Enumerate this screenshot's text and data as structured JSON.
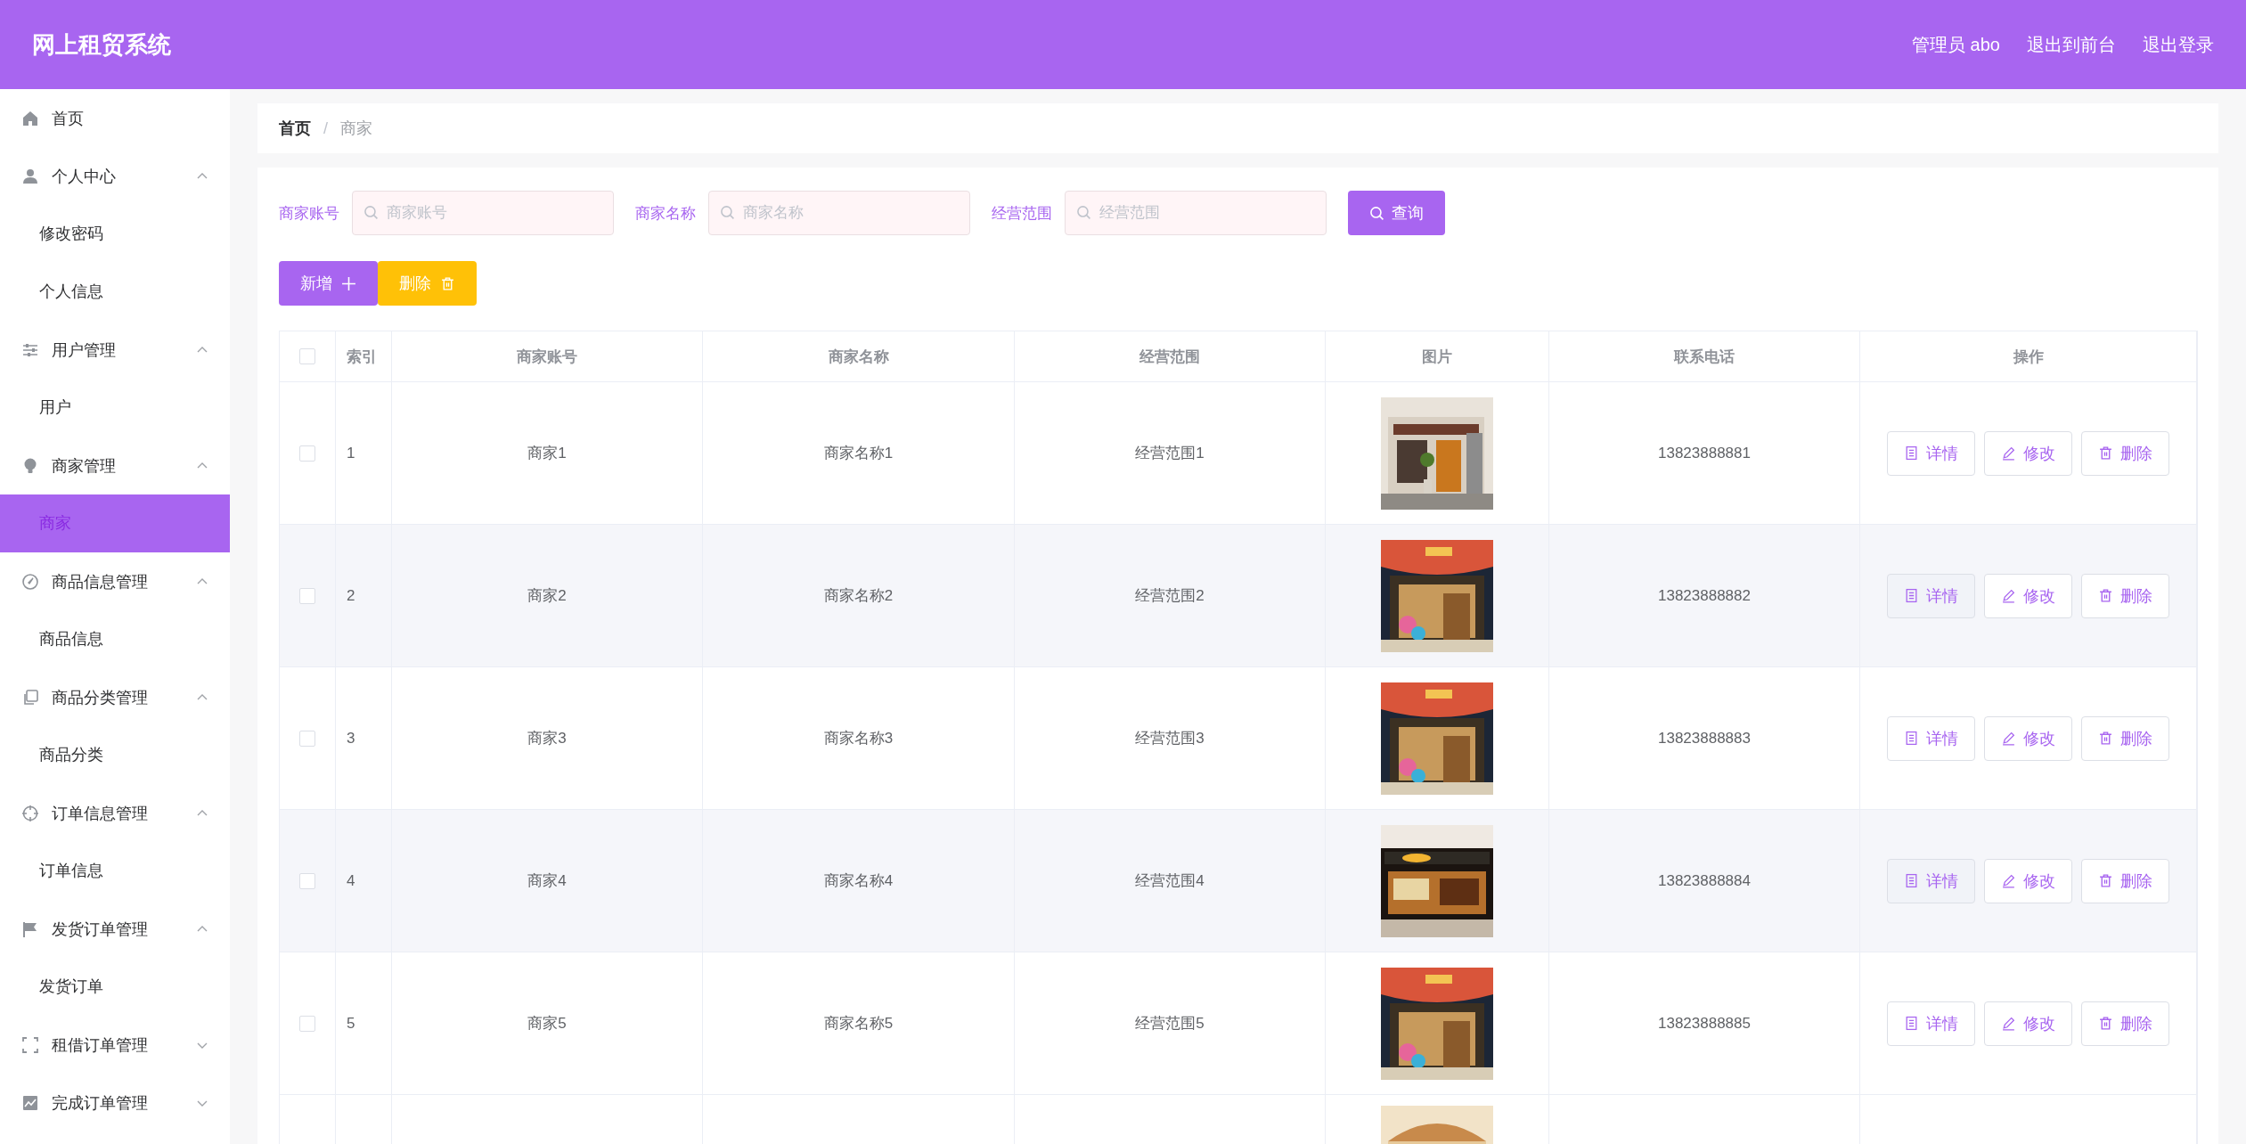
{
  "app": {
    "title": "网上租贸系统",
    "user_label": "管理员 abo",
    "links": [
      "退出到前台",
      "退出登录"
    ]
  },
  "sidebar": {
    "items": [
      {
        "label": "首页",
        "selected": false
      },
      {
        "label": "个人中心",
        "expanded": true,
        "children": [
          {
            "label": "修改密码",
            "selected": false
          },
          {
            "label": "个人信息",
            "selected": false
          }
        ]
      },
      {
        "label": "用户管理",
        "expanded": true,
        "children": [
          {
            "label": "用户",
            "selected": false
          }
        ]
      },
      {
        "label": "商家管理",
        "expanded": true,
        "children": [
          {
            "label": "商家",
            "selected": true
          }
        ]
      },
      {
        "label": "商品信息管理",
        "expanded": true,
        "children": [
          {
            "label": "商品信息",
            "selected": false
          }
        ]
      },
      {
        "label": "商品分类管理",
        "expanded": true,
        "children": [
          {
            "label": "商品分类",
            "selected": false
          }
        ]
      },
      {
        "label": "订单信息管理",
        "expanded": true,
        "children": [
          {
            "label": "订单信息",
            "selected": false
          }
        ]
      },
      {
        "label": "发货订单管理",
        "expanded": true,
        "children": [
          {
            "label": "发货订单",
            "selected": false
          }
        ]
      },
      {
        "label": "租借订单管理",
        "expanded": false
      },
      {
        "label": "完成订单管理",
        "expanded": false
      }
    ]
  },
  "breadcrumb": {
    "items": [
      "首页",
      "商家"
    ],
    "separator": "/"
  },
  "search": {
    "fields": [
      {
        "label": "商家账号",
        "placeholder": "商家账号"
      },
      {
        "label": "商家名称",
        "placeholder": "商家名称"
      },
      {
        "label": "经营范围",
        "placeholder": "经营范围"
      }
    ],
    "button": "查询"
  },
  "actions": [
    {
      "label": "新增",
      "kind": "add"
    },
    {
      "label": "删除",
      "kind": "delete"
    }
  ],
  "table": {
    "select_all": {
      "checked": false
    },
    "columns": [
      "索引",
      "商家账号",
      "商家名称",
      "经营范围",
      "图片",
      "联系电话",
      "操作"
    ],
    "rows": [
      {
        "checked": false,
        "index": "1",
        "account": "商家1",
        "name": "商家名称1",
        "scope": "经营范围1",
        "picture": {
          "kind": "picture"
        },
        "phone": "13823888881",
        "actions": [
          "详情",
          "修改",
          "删除"
        ]
      },
      {
        "checked": false,
        "index": "2",
        "account": "商家2",
        "name": "商家名称2",
        "scope": "经营范围2",
        "picture": {
          "kind": "picture"
        },
        "phone": "13823888882",
        "actions": [
          "详情",
          "修改",
          "删除"
        ]
      },
      {
        "checked": false,
        "index": "3",
        "account": "商家3",
        "name": "商家名称3",
        "scope": "经营范围3",
        "picture": {
          "kind": "picture"
        },
        "phone": "13823888883",
        "actions": [
          "详情",
          "修改",
          "删除"
        ]
      },
      {
        "checked": false,
        "index": "4",
        "account": "商家4",
        "name": "商家名称4",
        "scope": "经营范围4",
        "picture": {
          "kind": "picture"
        },
        "phone": "13823888884",
        "actions": [
          "详情",
          "修改",
          "删除"
        ]
      },
      {
        "checked": false,
        "index": "5",
        "account": "商家5",
        "name": "商家名称5",
        "scope": "经营范围5",
        "picture": {
          "kind": "picture"
        },
        "phone": "13823888885",
        "actions": [
          "详情",
          "修改",
          "删除"
        ]
      },
      {
        "picture": {
          "kind": "picture"
        }
      }
    ]
  }
}
